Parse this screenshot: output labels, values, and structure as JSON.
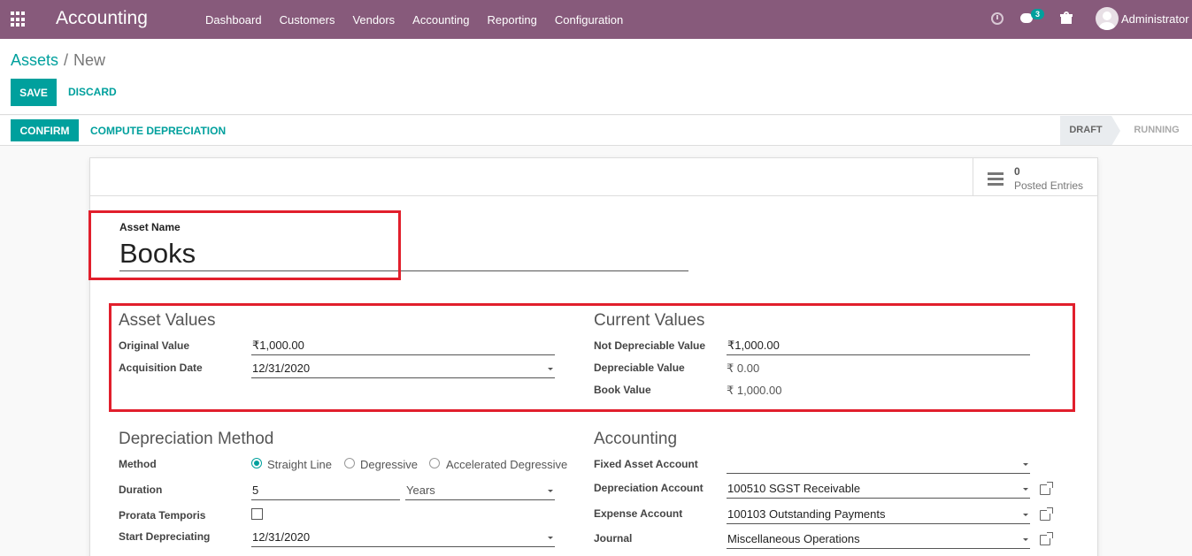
{
  "navbar": {
    "brand": "Accounting",
    "menu": [
      "Dashboard",
      "Customers",
      "Vendors",
      "Accounting",
      "Reporting",
      "Configuration"
    ],
    "chat_count": "3",
    "user_name": "Administrator",
    "icons": [
      "apps-icon",
      "clock-icon",
      "chat-icon",
      "gift-icon",
      "avatar"
    ],
    "color": "#875a7b"
  },
  "breadcrumb": {
    "parent": "Assets",
    "separator": "/",
    "current": "New"
  },
  "actions": {
    "save": "SAVE",
    "discard": "DISCARD"
  },
  "header": {
    "confirm": "CONFIRM",
    "compute": "COMPUTE DEPRECIATION",
    "stages": [
      "DRAFT",
      "RUNNING"
    ],
    "active_stage": "DRAFT"
  },
  "stat_button": {
    "value": "0",
    "label": "Posted Entries"
  },
  "asset": {
    "name_label": "Asset Name",
    "name": "Books"
  },
  "asset_values": {
    "title": "Asset Values",
    "original_value_label": "Original Value",
    "original_value": "₹1,000.00",
    "acquisition_date_label": "Acquisition Date",
    "acquisition_date": "12/31/2020"
  },
  "current_values": {
    "title": "Current Values",
    "not_depreciable_label": "Not Depreciable Value",
    "not_depreciable": "₹1,000.00",
    "depreciable_label": "Depreciable Value",
    "depreciable": "₹ 0.00",
    "book_value_label": "Book Value",
    "book_value": "₹ 1,000.00"
  },
  "depreciation": {
    "title": "Depreciation Method",
    "method_label": "Method",
    "methods": [
      "Straight Line",
      "Degressive",
      "Accelerated Degressive"
    ],
    "selected_method": "Straight Line",
    "duration_label": "Duration",
    "duration": "5",
    "duration_unit": "Years",
    "prorata_label": "Prorata Temporis",
    "prorata_checked": false,
    "start_label": "Start Depreciating",
    "start_date": "12/31/2020"
  },
  "accounting": {
    "title": "Accounting",
    "fixed_asset_label": "Fixed Asset Account",
    "fixed_asset": "",
    "depreciation_label": "Depreciation Account",
    "depreciation": "100510 SGST Receivable",
    "expense_label": "Expense Account",
    "expense": "100103 Outstanding Payments",
    "journal_label": "Journal",
    "journal": "Miscellaneous Operations"
  },
  "colors": {
    "accent": "#00a09d",
    "highlight": "#e11f2c"
  }
}
